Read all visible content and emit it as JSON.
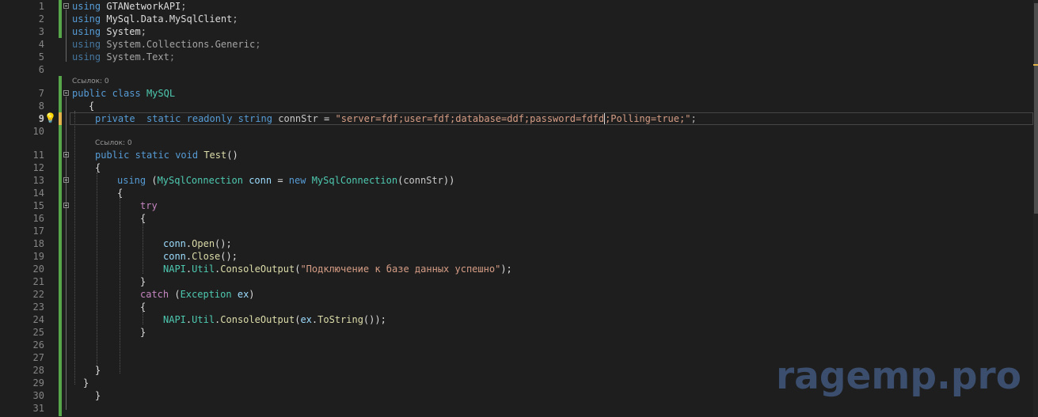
{
  "editor": {
    "line_numbers": [
      "1",
      "2",
      "3",
      "4",
      "5",
      "6",
      "7",
      "8",
      "9",
      "10",
      "11",
      "12",
      "13",
      "14",
      "15",
      "16",
      "17",
      "18",
      "19",
      "20",
      "21",
      "22",
      "23",
      "24",
      "25",
      "26",
      "27",
      "28",
      "29",
      "30",
      "31"
    ],
    "code_lens": {
      "class_refs": "Ссылок: 0",
      "method_refs": "Ссылок: 0"
    },
    "lines": {
      "l1": {
        "kw": "using",
        "ns": "GTANetworkAPI",
        "end": ";"
      },
      "l2": {
        "kw": "using",
        "ns": "MySql.Data.MySqlClient",
        "end": ";"
      },
      "l3": {
        "kw": "using",
        "ns": "System",
        "end": ";"
      },
      "l4": {
        "kw": "using",
        "ns": "System.Collections.Generic",
        "end": ";"
      },
      "l5": {
        "kw": "using",
        "ns": "System.Text",
        "end": ";"
      },
      "l7": {
        "kw1": "public",
        "kw2": "class",
        "name": "MySQL"
      },
      "l8": {
        "text": "{"
      },
      "l9": {
        "kw1": "private",
        "kw2": "static",
        "kw3": "readonly",
        "kw4": "string",
        "var": "connStr",
        "op": " = ",
        "str_a": "\"server=fdf;user=fdf;database=ddf;password=fdfd",
        "str_b": ";Polling=true;\"",
        "end": ";"
      },
      "l11": {
        "kw1": "public",
        "kw2": "static",
        "kw3": "void",
        "name": "Test",
        "end": "()"
      },
      "l12": {
        "text": "{"
      },
      "l13": {
        "kw": "using",
        "p1": " (",
        "type": "MySqlConnection",
        "var": "conn",
        "op": " = ",
        "kw_new": "new",
        "ctor": "MySqlConnection",
        "p2": "(",
        "arg": "connStr",
        "p3": "))"
      },
      "l14": {
        "text": "{"
      },
      "l15": {
        "kw": "try"
      },
      "l16": {
        "text": "{"
      },
      "l18": {
        "obj": "conn",
        "dot": ".",
        "method": "Open",
        "end": "();"
      },
      "l19": {
        "obj": "conn",
        "dot": ".",
        "method": "Close",
        "end": "();"
      },
      "l20": {
        "cls": "NAPI",
        "dot1": ".",
        "cls2": "Util",
        "dot2": ".",
        "method": "ConsoleOutput",
        "p1": "(",
        "str": "\"Подключение к базе данных успешно\"",
        "end": ");"
      },
      "l21": {
        "text": "}"
      },
      "l22": {
        "kw": "catch",
        "p1": " (",
        "type": "Exception",
        "var": "ex",
        "p2": ")"
      },
      "l23": {
        "text": "{"
      },
      "l24": {
        "cls": "NAPI",
        "dot1": ".",
        "cls2": "Util",
        "dot2": ".",
        "method": "ConsoleOutput",
        "p1": "(",
        "var": "ex",
        "dot3": ".",
        "method2": "ToString",
        "end": "());"
      },
      "l25": {
        "text": "}"
      },
      "l28": {
        "text": "}"
      },
      "l29": {
        "text": "}"
      },
      "l30": {
        "text": "}"
      }
    }
  },
  "watermark": {
    "text": "ragemp.pro"
  },
  "colors": {
    "keyword": "#569cd6",
    "type": "#4ec9b0",
    "string": "#d69d85",
    "variable": "#9cdcfe",
    "method": "#dcdcaa",
    "control": "#c586c0",
    "change_bar": "#57a64a",
    "change_bar_unsaved": "#e2b34a"
  },
  "icons": {
    "lightbulb": "lightbulb-icon"
  }
}
